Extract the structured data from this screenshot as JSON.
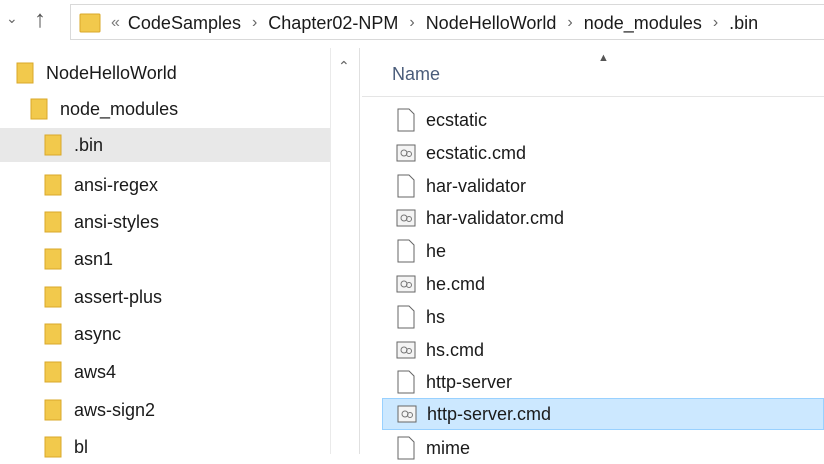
{
  "address_bar": {
    "overflow_indicator": "«",
    "crumbs": [
      "CodeSamples",
      "Chapter02-NPM",
      "NodeHelloWorld",
      "node_modules",
      ".bin"
    ]
  },
  "tree": {
    "items": [
      {
        "label": "NodeHelloWorld"
      },
      {
        "label": "node_modules"
      },
      {
        "label": ".bin",
        "selected": true
      },
      {
        "label": "ansi-regex"
      },
      {
        "label": "ansi-styles"
      },
      {
        "label": "asn1"
      },
      {
        "label": "assert-plus"
      },
      {
        "label": "async"
      },
      {
        "label": "aws4"
      },
      {
        "label": "aws-sign2"
      },
      {
        "label": "bl"
      }
    ]
  },
  "file_list": {
    "column_name": "Name",
    "files": [
      {
        "name": "ecstatic",
        "icon": "file-icon"
      },
      {
        "name": "ecstatic.cmd",
        "icon": "cmd-file-icon"
      },
      {
        "name": "har-validator",
        "icon": "file-icon"
      },
      {
        "name": "har-validator.cmd",
        "icon": "cmd-file-icon"
      },
      {
        "name": "he",
        "icon": "file-icon"
      },
      {
        "name": "he.cmd",
        "icon": "cmd-file-icon"
      },
      {
        "name": "hs",
        "icon": "file-icon"
      },
      {
        "name": "hs.cmd",
        "icon": "cmd-file-icon"
      },
      {
        "name": "http-server",
        "icon": "file-icon"
      },
      {
        "name": "http-server.cmd",
        "icon": "cmd-file-icon",
        "selected": true
      },
      {
        "name": "mime",
        "icon": "file-icon"
      }
    ]
  },
  "colors": {
    "folder": "#f2c94c",
    "selection": "#cce8ff",
    "tree_selection": "#e8e8e8"
  }
}
